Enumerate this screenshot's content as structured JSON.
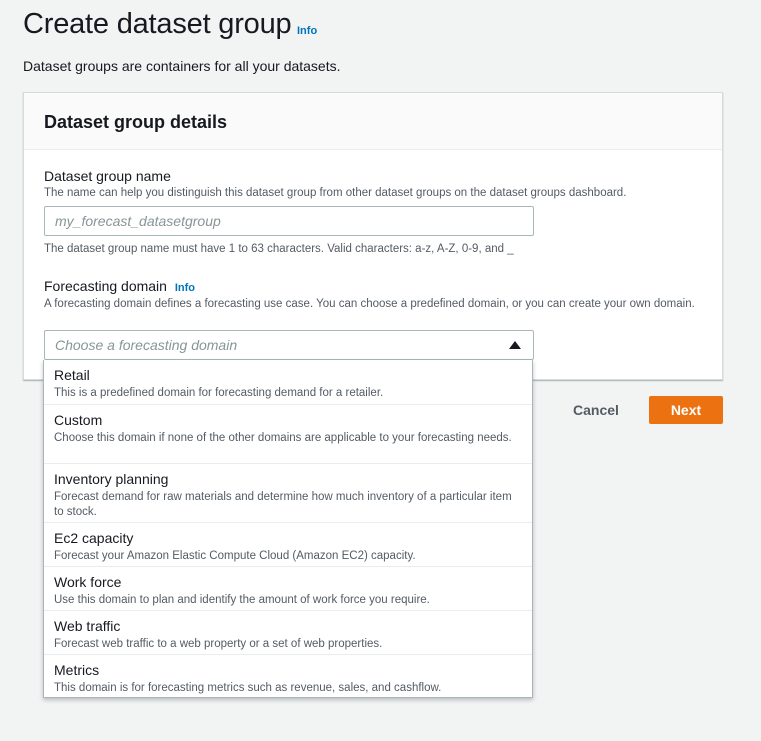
{
  "page": {
    "title": "Create dataset group",
    "info_label": "Info",
    "description": "Dataset groups are containers for all your datasets."
  },
  "container": {
    "title": "Dataset group details"
  },
  "name_field": {
    "label": "Dataset group name",
    "description": "The name can help you distinguish this dataset group from other dataset groups on the dataset groups dashboard.",
    "placeholder": "my_forecast_datasetgroup",
    "value": "",
    "constraint": "The dataset group name must have 1 to 63 characters. Valid characters: a-z, A-Z, 0-9, and _"
  },
  "domain_field": {
    "label": "Forecasting domain",
    "info_label": "Info",
    "description": "A forecasting domain defines a forecasting use case. You can choose a predefined domain, or you can create your own domain.",
    "placeholder": "Choose a forecasting domain",
    "options": [
      {
        "label": "Retail",
        "description": "This is a predefined domain for forecasting demand for a retailer."
      },
      {
        "label": "Custom",
        "description": "Choose this domain if none of the other domains are applicable to your forecasting needs."
      },
      {
        "label": "Inventory planning",
        "description": "Forecast demand for raw materials and determine how much inventory of a particular item to stock."
      },
      {
        "label": "Ec2 capacity",
        "description": "Forecast your Amazon Elastic Compute Cloud (Amazon EC2) capacity."
      },
      {
        "label": "Work force",
        "description": "Use this domain to plan and identify the amount of work force you require."
      },
      {
        "label": "Web traffic",
        "description": "Forecast web traffic to a web property or a set of web properties."
      },
      {
        "label": "Metrics",
        "description": "This domain is for forecasting metrics such as revenue, sales, and cashflow."
      }
    ]
  },
  "actions": {
    "cancel_label": "Cancel",
    "next_label": "Next"
  },
  "colors": {
    "primary_button": "#ec7211",
    "link": "#0073bb",
    "page_background": "#f2f3f3"
  }
}
